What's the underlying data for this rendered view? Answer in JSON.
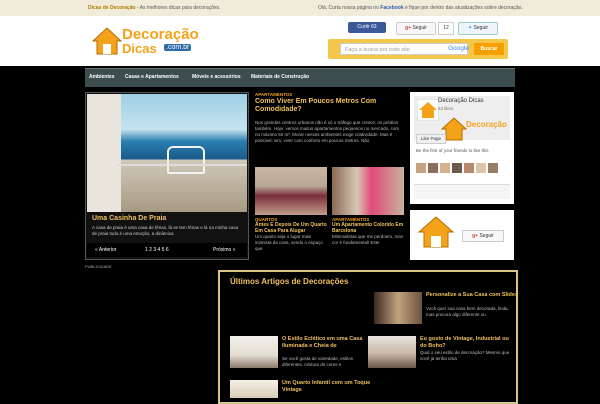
{
  "topbar": {
    "brand": "Dicas de Decoração",
    "tagline": " - As melhores dicas para decorações.",
    "right_pre": "Olá, Curta nossa página no ",
    "right_link": "Facebook",
    "right_post": " e fique por dentro das atualizações sobre decoração."
  },
  "social": {
    "fb_label": "Curtir 63",
    "gplus_label": "Seguir",
    "gplus_count": "12",
    "twitter_label": "Seguir"
  },
  "logo": {
    "line1": "Decoração",
    "line2": "Dicas",
    "domain": ".com.br"
  },
  "search": {
    "placeholder": "Faça a busca por todo site",
    "google": "Google",
    "button": "Buscar"
  },
  "nav": {
    "items": [
      "Ambientes",
      "Casas e Apartamentos",
      "Móveis e acessórios",
      "Materiais de Construção"
    ]
  },
  "slider": {
    "caption": "Uma Casinha De Praia",
    "description": "A casa de praia é uma casa de férias, lá se tem férias e lá na minha casa de praia tudo é uma emoção, a dinâmica",
    "prev": "« Anterior",
    "pages": "1  2  3  4  5  6",
    "next": "Próximo »"
  },
  "featured": {
    "tag": "APARTAMENTOS",
    "title": "Como Viver Em Poucos Metros Com Comodidade?",
    "body": "Nos grandes centros urbanos não é só o tráfego que cresce; os prédios também. Hoje, vemos muitos apartamentos pequenos no mercado, com no máximo 50 m². Morar nesses ambientes exige criatividade. Mas é possível, sim, viver com conforto em poucos metros. Não"
  },
  "cards": [
    {
      "tag": "QUARTOS",
      "title": "Antes E Depois De Um Quarto Em Casa Para Alugar",
      "desc": "Um quarto seja o lugar mais intimista da casa, sendo o espaço que"
    },
    {
      "tag": "APARTAMENTOS",
      "title": "Um Apartamento Colorido Em Barcelona",
      "desc": "Minimalistas que me perdoem, mas cor é fundamental! Este"
    }
  ],
  "widget": {
    "name": "Decoração Dicas",
    "likes": "63 likes",
    "like_btn": "Like Page",
    "friends": "Be the first of your friends to like this"
  },
  "gwidget": {
    "follow": "Seguir"
  },
  "publicidade": "PUBLICIDADE",
  "ultimos": {
    "title": "Últimos Artigos de Decorações",
    "articles": [
      {
        "title": "Personalize a Sua Casa com Slides",
        "desc": "Você quer sua casa bem decorada, linda, mas procura algo diferente ou"
      },
      {
        "title": "O Estilo Eclético em uma Casa Iluminada e Cheia de",
        "desc": "Se você gosta de variedade, estilos diferentes, mistura de cores e"
      },
      {
        "title": "Eu gosto de Vintage, Industrial ou do Boho?",
        "desc": "Qual o seu estilo de decoração? Mesmo que você já tenha uma"
      },
      {
        "title": "Um Quarto Infantil com um Toque Vintage",
        "desc": ""
      }
    ]
  }
}
